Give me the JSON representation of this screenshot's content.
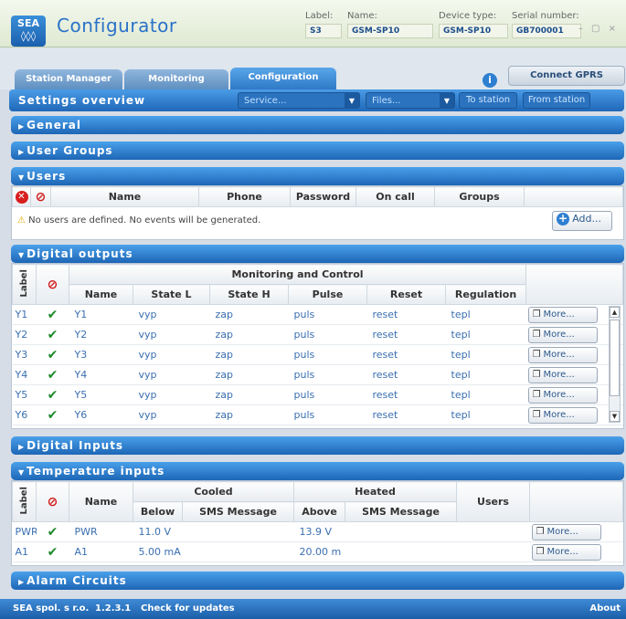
{
  "app": {
    "logo_text": "SEA",
    "title": "Configurator",
    "label_caption": "Label:",
    "label_value": "S3",
    "name_caption": "Name:",
    "name_value": "GSM-SP10",
    "device_caption": "Device type:",
    "device_value": "GSM-SP10",
    "serial_caption": "Serial number:",
    "serial_value": "GB700001",
    "window_controls": "– ▢ ×"
  },
  "tabs": [
    "Station Manager",
    "Monitoring",
    "Configuration"
  ],
  "active_tab": "Configuration",
  "connect_gprs": "Connect GPRS",
  "info_icon": "i",
  "settings": {
    "title": "Settings overview",
    "service_select": "Service...",
    "files_select": "Files...",
    "to_station": "To station",
    "from_station": "From station"
  },
  "sections": {
    "general": "General",
    "user_groups": "User Groups",
    "users": "Users",
    "digital_outputs": "Digital outputs",
    "digital_inputs": "Digital Inputs",
    "temperature_inputs": "Temperature inputs",
    "alarm_circuits": "Alarm Circuits"
  },
  "users": {
    "columns": [
      "Name",
      "Phone",
      "Password",
      "On call",
      "Groups"
    ],
    "warning": "No users are defined. No events will be generated.",
    "add_button": "Add..."
  },
  "digital_outputs": {
    "label_header": "Label",
    "group_header": "Monitoring and Control",
    "columns": [
      "Name",
      "State L",
      "State H",
      "Pulse",
      "Reset",
      "Regulation"
    ],
    "more_label": "More...",
    "rows": [
      {
        "label": "Y1",
        "name": "Y1",
        "state_l": "vyp",
        "state_h": "zap",
        "pulse": "puls",
        "reset": "reset",
        "regulation": "tepl"
      },
      {
        "label": "Y2",
        "name": "Y2",
        "state_l": "vyp",
        "state_h": "zap",
        "pulse": "puls",
        "reset": "reset",
        "regulation": "tepl"
      },
      {
        "label": "Y3",
        "name": "Y3",
        "state_l": "vyp",
        "state_h": "zap",
        "pulse": "puls",
        "reset": "reset",
        "regulation": "tepl"
      },
      {
        "label": "Y4",
        "name": "Y4",
        "state_l": "vyp",
        "state_h": "zap",
        "pulse": "puls",
        "reset": "reset",
        "regulation": "tepl"
      },
      {
        "label": "Y5",
        "name": "Y5",
        "state_l": "vyp",
        "state_h": "zap",
        "pulse": "puls",
        "reset": "reset",
        "regulation": "tepl"
      },
      {
        "label": "Y6",
        "name": "Y6",
        "state_l": "vyp",
        "state_h": "zap",
        "pulse": "puls",
        "reset": "reset",
        "regulation": "tepl"
      }
    ]
  },
  "temperature_inputs": {
    "label_header": "Label",
    "name_header": "Name",
    "cooled_header": "Cooled",
    "heated_header": "Heated",
    "users_header": "Users",
    "below_header": "Below",
    "above_header": "Above",
    "sms_header": "SMS Message",
    "more_label": "More...",
    "rows": [
      {
        "label": "PWR",
        "name": "PWR",
        "below": "11.0 V",
        "cool_sms": "",
        "above": "13.9 V",
        "heat_sms": "",
        "users": ""
      },
      {
        "label": "A1",
        "name": "A1",
        "below": "5.00 mA",
        "cool_sms": "",
        "above": "20.00 m",
        "heat_sms": "",
        "users": ""
      }
    ]
  },
  "footer": {
    "company": "SEA spol. s r.o.",
    "version": "1.2.3.1",
    "updates": "Check for updates",
    "about": "About"
  },
  "colors": {
    "accent": "#2f79c6",
    "check": "#1c8a2a",
    "error": "#d81e1e"
  }
}
